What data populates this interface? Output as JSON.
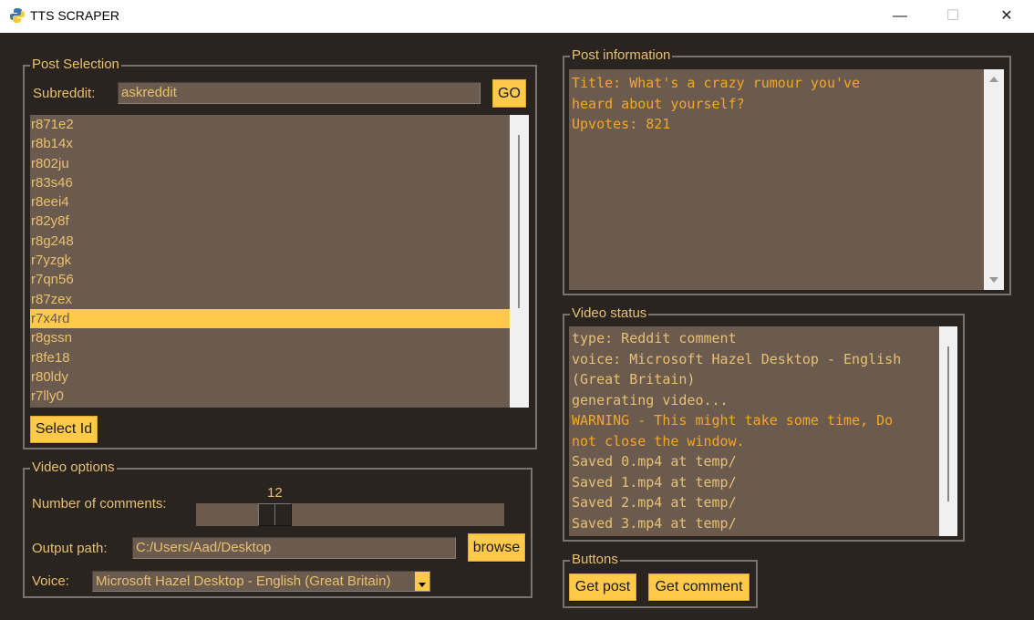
{
  "window": {
    "title": "TTS SCRAPER",
    "minimize": "—",
    "maximize": "☐",
    "close": "✕"
  },
  "post_selection": {
    "legend": "Post Selection",
    "subreddit_label": "Subreddit:",
    "subreddit_value": "askreddit",
    "go_label": "GO",
    "ids": [
      "r871e2",
      "r8b14x",
      "r802ju",
      "r83s46",
      "r8eei4",
      "r82y8f",
      "r8g248",
      "r7yzgk",
      "r7qn56",
      "r87zex",
      "r7x4rd",
      "r8gssn",
      "r8fe18",
      "r80ldy",
      "r7lly0"
    ],
    "selected_index": 10,
    "select_label": "Select Id"
  },
  "video_options": {
    "legend": "Video options",
    "comments_label": "Number of comments:",
    "comments_value": "12",
    "output_label": "Output path:",
    "output_value": "C:/Users/Aad/Desktop",
    "browse_label": "browse",
    "voice_label": "Voice:",
    "voice_value": "Microsoft Hazel Desktop - English (Great Britain)"
  },
  "post_information": {
    "legend": "Post information",
    "lines": [
      "Title: What's a crazy rumour you've",
      "heard about yourself?",
      "Upvotes: 821"
    ]
  },
  "video_status": {
    "legend": "Video status",
    "lines": [
      {
        "text": "type: Reddit comment",
        "tone": "tan"
      },
      {
        "text": "voice: Microsoft Hazel Desktop - English",
        "tone": "tan"
      },
      {
        "text": "(Great Britain)",
        "tone": "tan"
      },
      {
        "text": "generating video...",
        "tone": "tan"
      },
      {
        "text": "WARNING - This might take some time, Do",
        "tone": "orange"
      },
      {
        "text": "not close the window.",
        "tone": "orange"
      },
      {
        "text": "Saved 0.mp4 at temp/",
        "tone": "tan"
      },
      {
        "text": "Saved 1.mp4 at temp/",
        "tone": "tan"
      },
      {
        "text": "Saved 2.mp4 at temp/",
        "tone": "tan"
      },
      {
        "text": "Saved 3.mp4 at temp/",
        "tone": "tan"
      }
    ]
  },
  "buttons": {
    "legend": "Buttons",
    "get_post": "Get post",
    "get_comment": "Get comment"
  }
}
